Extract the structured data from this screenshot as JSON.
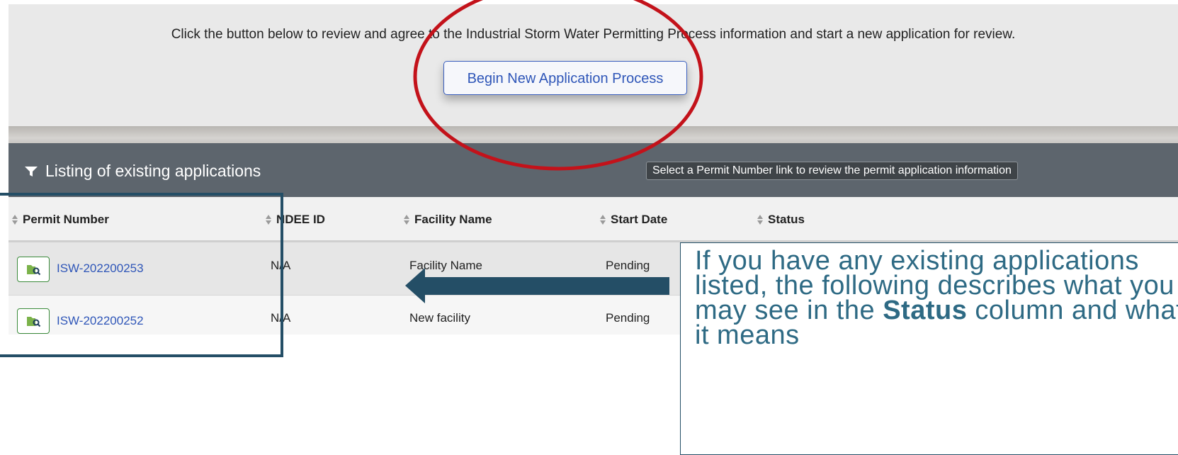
{
  "intro": {
    "text": "Click the button below to review and agree to the Industrial Storm Water Permitting Process information and start a new application for review.",
    "begin_button_label": "Begin New Application Process"
  },
  "listing": {
    "title": "Listing of existing applications",
    "title_icon": "filter-icon",
    "hint": "Select a Permit Number link to review the permit application information"
  },
  "table": {
    "columns": [
      "Permit Number",
      "NDEE ID",
      "Facility Name",
      "Start Date",
      "Status"
    ],
    "rows": [
      {
        "permit_number": "ISW-202200253",
        "ndee_id": "N/A",
        "facility_name": "Facility Name",
        "start_date": "Pending",
        "status": ""
      },
      {
        "permit_number": "ISW-202200252",
        "ndee_id": "N/A",
        "facility_name": "New facility",
        "start_date": "Pending",
        "status": ""
      }
    ]
  },
  "callout": {
    "text_before": "If you have any existing applications listed, the following describes what you may see in the",
    "text_bold": "Status",
    "text_after": "column and what it means"
  },
  "colors": {
    "header_bg": "#5d656d",
    "link": "#2f56b8",
    "annotation_blue": "#244e66",
    "annotation_red": "#c3121a",
    "callout_text": "#2e6a84"
  }
}
